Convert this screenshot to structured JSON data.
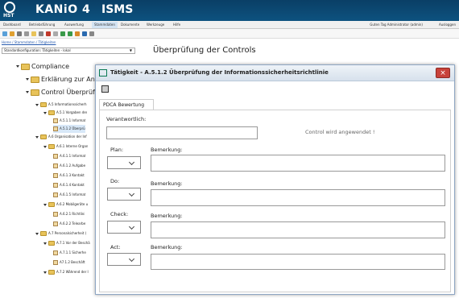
{
  "brand": {
    "logo_text": "HST",
    "name": "KANiO 4",
    "module": "ISMS"
  },
  "menu": {
    "items": [
      "Dashboard",
      "Betriebsführung",
      "Auswertung",
      "Stammdaten",
      "Dokumente",
      "Werkzeuge",
      "Hilfe"
    ],
    "greeting": "Guten Tag Administrator (admin)",
    "logout": "Ausloggen"
  },
  "breadcrumb": "Home / Stammdaten / Tätigkeiten",
  "config_select": "Standardkonfiguration: Tätigkeiten - lokal",
  "section_title": "Überprüfung der Controls",
  "tree": {
    "compliance": "Compliance",
    "erklaerung": "Erklärung zur Anw",
    "control": "Control Überprüfu",
    "items": [
      "A.5 Informationssicherh",
      "A.5.1 Vorgaben der",
      "A.5.1.1 Informat",
      "A.5.1.2 Überprü",
      "A.6 Organisation der Inf",
      "A.6.1 Interne Organ",
      "A.6.1.1 Informat",
      "A.6.1.2 Aufgabe",
      "A.6.1.3 Kontakt",
      "A.6.1.4 Kontakt",
      "A.6.1.5 Informat",
      "A.6.2 Mobilgeräte u",
      "A.6.2.1 Richtlini",
      "A.6.2.2 Telearbe",
      "A.7 Personalsicherheit (",
      "A.7.1 Vor der Beschä",
      "A.7.1.1 Sicherhe",
      "A7.1.2 Beschäft",
      "A.7.2 Während der I"
    ]
  },
  "modal": {
    "title": "Tätigkeit - A.5.1.2 Überprüfung der Informationssicherheitsrichtlinie",
    "close": "×",
    "tab": "PDCA Bewertung",
    "verantwortlich_label": "Verantwortlich:",
    "note": "Control wird angewendet !",
    "rows": [
      {
        "label": "Plan:",
        "bemerkung": "Bemerkung:"
      },
      {
        "label": "Do:",
        "bemerkung": "Bemerkung:"
      },
      {
        "label": "Check:",
        "bemerkung": "Bemerkung:"
      },
      {
        "label": "Act:",
        "bemerkung": "Bemerkung:"
      }
    ]
  },
  "colors": {
    "header": "#0d527f",
    "close": "#c8423a",
    "folder": "#e8c35a"
  }
}
